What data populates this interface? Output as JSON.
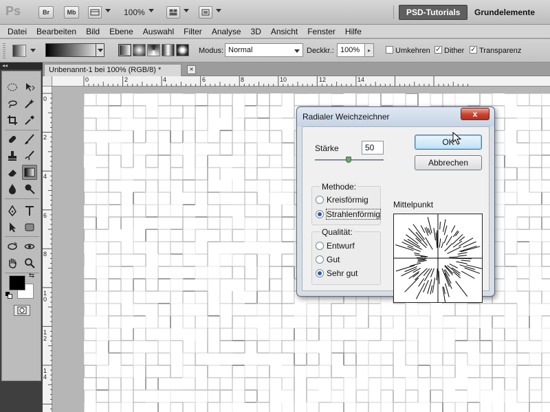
{
  "appbar": {
    "logo": "Ps",
    "bridge_label": "Br",
    "minibridge_label": "Mb",
    "zoom": "100%",
    "workspaces": [
      "PSD-Tutorials",
      "Grundelemente"
    ]
  },
  "menubar": {
    "items": [
      "Datei",
      "Bearbeiten",
      "Bild",
      "Ebene",
      "Auswahl",
      "Filter",
      "Analyse",
      "3D",
      "Ansicht",
      "Fenster",
      "Hilfe"
    ]
  },
  "options": {
    "mode_label": "Modus:",
    "mode_value": "Normal",
    "opacity_label": "Deckkr.:",
    "opacity_value": "100%",
    "reverse_label": "Umkehren",
    "reverse_checked": false,
    "dither_label": "Dither",
    "dither_checked": true,
    "transparency_label": "Transparenz",
    "transparency_checked": true
  },
  "document": {
    "tab_title": "Unbenannt-1 bei 100% (RGB/8) *",
    "close": "×",
    "ruler_top": [
      "0",
      "2",
      "4",
      "6",
      "8",
      "10",
      "12",
      "14"
    ],
    "ruler_left": [
      "0",
      "2",
      "4",
      "6",
      "8",
      "10",
      "12",
      "14"
    ]
  },
  "toolbox": {
    "collapse": "◂◂"
  },
  "dialog": {
    "title": "Radialer Weichzeichner",
    "close": "x",
    "amount_label": "Stärke",
    "amount_value": "50",
    "ok_label": "OK",
    "cancel_label": "Abbrechen",
    "method_title": "Methode:",
    "methods": [
      "Kreisförmig",
      "Strahlenförmig"
    ],
    "method_selected": "Strahlenförmig",
    "quality_title": "Qualität:",
    "qualities": [
      "Entwurf",
      "Gut",
      "Sehr gut"
    ],
    "quality_selected": "Sehr gut",
    "center_label": "Mittelpunkt"
  }
}
